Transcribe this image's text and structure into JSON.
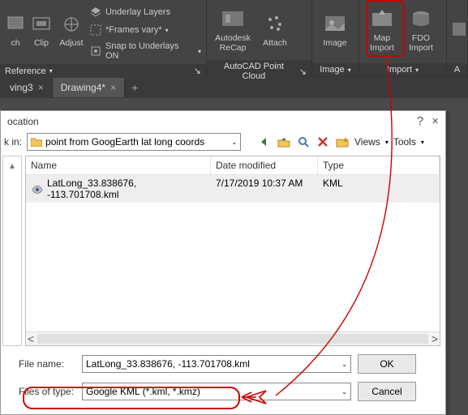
{
  "ribbon": {
    "ref_group": {
      "big": [
        {
          "label": "ch"
        },
        {
          "label": "Clip"
        },
        {
          "label": "Adjust"
        }
      ],
      "rows": [
        {
          "icon": "layers",
          "label": "Underlay Layers"
        },
        {
          "icon": "frames",
          "label": "*Frames vary* ",
          "caret": true
        },
        {
          "icon": "snap",
          "label": "Snap to Underlays ON ",
          "caret": true
        }
      ],
      "footer": "Reference"
    },
    "point_cloud": {
      "big": [
        {
          "label": "Autodesk ReCap"
        },
        {
          "label": "Attach"
        }
      ],
      "footer": "AutoCAD Point Cloud"
    },
    "image_group": {
      "big": [
        {
          "label": "Image"
        }
      ],
      "footer": "Image"
    },
    "import_group": {
      "big": [
        {
          "label": "Map Import"
        },
        {
          "label": "FDO Import"
        }
      ],
      "footer": "Import"
    }
  },
  "tabs": {
    "t1": "ving3",
    "t2": "Drawing4*"
  },
  "dialog": {
    "title": "ocation",
    "help": "?",
    "close": "×",
    "look_in_label": "k in:",
    "folder": "point from GoogEarth lat long coords",
    "views": "Views",
    "tools": "Tools",
    "cols": {
      "name": "Name",
      "date": "Date modified",
      "type": "Type"
    },
    "row": {
      "name": "LatLong_33.838676, -113.701708.kml",
      "date": "7/17/2019 10:37 AM",
      "type": "KML"
    },
    "file_name_label": "File name:",
    "file_name_value": "LatLong_33.838676, -113.701708.kml",
    "file_type_label": "Files of type:",
    "file_type_value": "Google KML (*.kml, *.kmz)",
    "ok": "OK",
    "cancel": "Cancel"
  }
}
